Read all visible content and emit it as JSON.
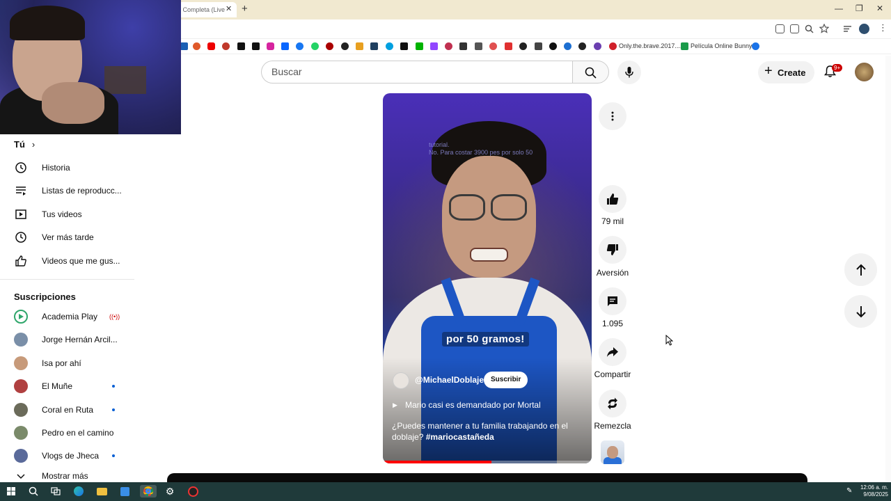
{
  "browser": {
    "tab_title": "i Completa (Live",
    "bookmarks": [
      {
        "label": "Only.the.brave.2017...."
      },
      {
        "label": "Película Online Bunny"
      }
    ]
  },
  "header": {
    "search_placeholder": "Buscar",
    "create_label": "Create",
    "notifications_badge": "9+"
  },
  "sidebar": {
    "you_label": "Tú",
    "you_items": [
      {
        "label": "Historia",
        "icon": "history-icon"
      },
      {
        "label": "Listas de reproducc...",
        "icon": "playlists-icon"
      },
      {
        "label": "Tus videos",
        "icon": "your-videos-icon"
      },
      {
        "label": "Ver más tarde",
        "icon": "watch-later-icon"
      },
      {
        "label": "Videos que me gus...",
        "icon": "liked-videos-icon"
      }
    ],
    "subscriptions_label": "Suscripciones",
    "subscriptions": [
      {
        "label": "Academia Play",
        "live": true,
        "new": false,
        "color": "#2fa66b"
      },
      {
        "label": "Jorge Hernán Arcil...",
        "live": false,
        "new": false,
        "color": "#7a8fa8"
      },
      {
        "label": "Isa por ahí",
        "live": false,
        "new": false,
        "color": "#c79a7a"
      },
      {
        "label": "El Muñe",
        "live": false,
        "new": true,
        "color": "#b04040"
      },
      {
        "label": "Coral en Ruta",
        "live": false,
        "new": true,
        "color": "#6b6b5a"
      },
      {
        "label": "Pedro en el camino",
        "live": false,
        "new": false,
        "color": "#7a8a6a"
      },
      {
        "label": "Vlogs de Jheca",
        "live": false,
        "new": true,
        "color": "#5a6a9a"
      }
    ],
    "show_more_label": "Mostrar más"
  },
  "short": {
    "overlay_text_line1": "tutorial.",
    "overlay_text_line2": "No. Para costar 3900 pes por solo 50",
    "caption": "por 50 gramos!",
    "channel": "@MichaelDoblaje",
    "subscribe_label": "Suscribir",
    "linked_video": "Mario casi es demandado por Mortal",
    "description": "¿Puedes mantener a tu familia trabajando en el doblaje?",
    "hashtag": "#mariocastañeda",
    "progress": 0.52
  },
  "actions": {
    "likes": "79 mil",
    "dislike_label": "Aversión",
    "comments": "1.095",
    "share_label": "Compartir",
    "remix_label": "Remezcla"
  },
  "taskbar": {
    "time": "12:06 a. m.",
    "date": "9/08/2025"
  }
}
